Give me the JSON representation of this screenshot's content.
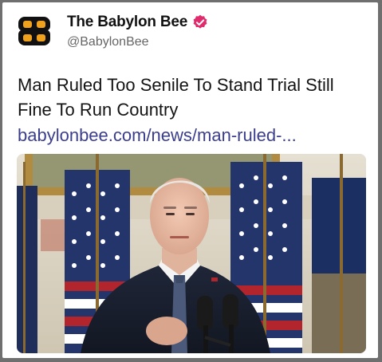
{
  "account": {
    "display_name": "The Babylon Bee",
    "handle": "@BabylonBee",
    "verified": true,
    "avatar_icon": "bee-logo-icon",
    "brand_color": "#f1a21d",
    "verified_color": "#e02b6d"
  },
  "post": {
    "text": "Man Ruled Too Senile To Stand Trial Still Fine To Run Country",
    "link": "babylonbee.com/news/man-ruled-...",
    "link_color": "#3b3e8f"
  },
  "media": {
    "icon": "news-photo-image"
  }
}
